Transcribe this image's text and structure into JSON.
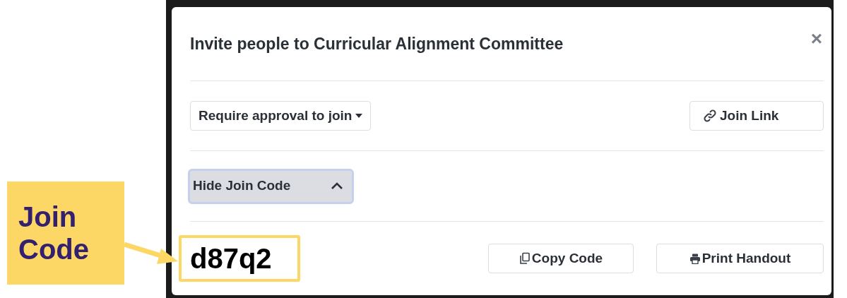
{
  "annotation": {
    "label": "Join Code"
  },
  "dialog": {
    "title": "Invite people to Curricular Alignment Committee",
    "close": "×",
    "approval_dropdown": "Require approval to join",
    "join_link_button": "Join Link",
    "code_toggle": {
      "label": "Hide Join Code",
      "expanded": true
    },
    "join_code": "d87q2",
    "buttons": [
      {
        "kind": "copy",
        "label": "Copy Code"
      },
      {
        "kind": "print",
        "label": "Print Handout"
      }
    ]
  }
}
